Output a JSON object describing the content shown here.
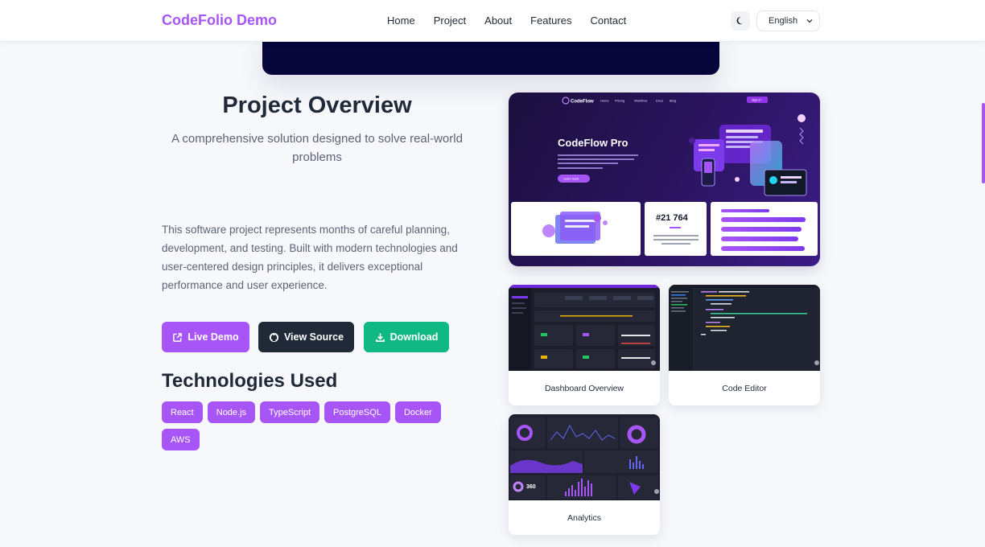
{
  "nav": {
    "brand": "CodeFolio Demo",
    "links": [
      "Home",
      "Project",
      "About",
      "Features",
      "Contact"
    ],
    "theme_icon": "moon-icon",
    "language": "English"
  },
  "overview": {
    "title": "Project Overview",
    "subtitle": "A comprehensive solution designed to solve real-world problems",
    "description": "This software project represents months of careful planning, development, and testing. Built with modern technologies and user-centered design principles, it delivers exceptional performance and user experience."
  },
  "buttons": {
    "live_demo": "Live Demo",
    "view_source": "View Source",
    "download": "Download"
  },
  "tech": {
    "title": "Technologies Used",
    "tags": [
      "React",
      "Node.js",
      "TypeScript",
      "PostgreSQL",
      "Docker",
      "AWS"
    ]
  },
  "main_screenshot": {
    "app_logo": "CodeFlow",
    "nav_items": [
      "Home",
      "Pricing",
      "Workflow",
      "Docs",
      "Blog"
    ],
    "cta": "Sign in",
    "hero_title": "CodeFlow Pro",
    "hero_button": "Learn more",
    "stat_value": "#21 764"
  },
  "gallery": [
    {
      "caption": "Dashboard Overview"
    },
    {
      "caption": "Code Editor"
    },
    {
      "caption": "Analytics",
      "stat": "360"
    }
  ],
  "colors": {
    "brand": "#a855f7",
    "dark": "#1f2937",
    "success": "#10b981"
  }
}
